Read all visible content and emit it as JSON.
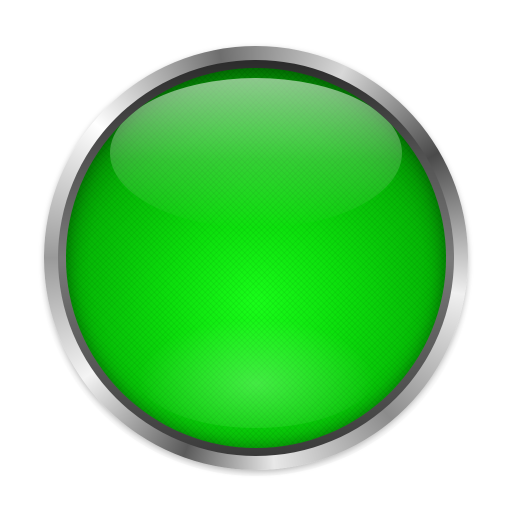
{
  "button": {
    "state": "on",
    "face_color": "#0ce00c",
    "bezel_color": "#c8c8c8",
    "icon": "green-round-button-icon"
  }
}
